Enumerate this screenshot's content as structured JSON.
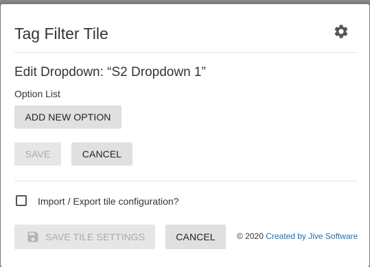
{
  "dialog": {
    "title": "Tag Filter Tile",
    "settings_icon": "gear-icon"
  },
  "editor": {
    "heading": "Edit Dropdown: “S2 Dropdown 1”",
    "option_list_label": "Option List",
    "add_option_label": "ADD NEW OPTION",
    "save_label": "SAVE",
    "save_enabled": false,
    "cancel_label": "CANCEL"
  },
  "config": {
    "import_export_label": "Import / Export tile configuration?",
    "import_export_checked": false
  },
  "footer": {
    "save_tile_label": "SAVE TILE SETTINGS",
    "save_tile_icon": "floppy-disk-icon",
    "save_tile_enabled": false,
    "cancel_label": "CANCEL",
    "copyright": "© 2020",
    "credit_link": "Created by Jive Software"
  },
  "colors": {
    "link": "#1a6fb5",
    "button_bg": "#e0e0e0",
    "disabled_text": "#aaaaaa"
  }
}
